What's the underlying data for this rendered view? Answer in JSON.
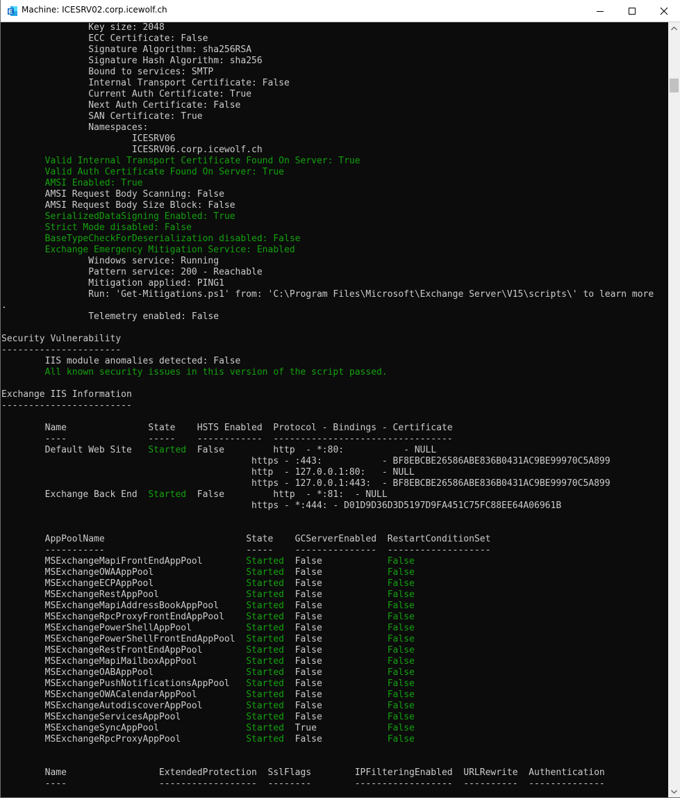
{
  "window": {
    "title": "Machine: ICESRV02.corp.icewolf.ch",
    "icon": "exchange-app-icon",
    "controls": {
      "minimize": "minimize-icon",
      "maximize": "maximize-icon",
      "close": "close-icon"
    }
  },
  "colors": {
    "background": "#0c0c0c",
    "text": "#cccccc",
    "green": "#13a10e",
    "titlebar": "#ffffff",
    "exchange_blue": "#0f6ec6"
  },
  "scrollbar": {
    "thumb_position": 0.06
  },
  "console": {
    "lines": [
      {
        "text": "                Key size: 2048"
      },
      {
        "text": "                ECC Certificate: False"
      },
      {
        "text": "                Signature Algorithm: sha256RSA"
      },
      {
        "text": "                Signature Hash Algorithm: sha256"
      },
      {
        "text": "                Bound to services: SMTP"
      },
      {
        "text": "                Internal Transport Certificate: False"
      },
      {
        "text": "                Current Auth Certificate: True"
      },
      {
        "text": "                Next Auth Certificate: False"
      },
      {
        "text": "                SAN Certificate: True"
      },
      {
        "text": "                Namespaces:"
      },
      {
        "text": "                        ICESRV06"
      },
      {
        "text": "                        ICESRV06.corp.icewolf.ch"
      },
      {
        "text": "        Valid Internal Transport Certificate Found On Server: True",
        "color": "green"
      },
      {
        "text": "        Valid Auth Certificate Found On Server: True",
        "color": "green"
      },
      {
        "text": "        AMSI Enabled: True",
        "color": "green"
      },
      {
        "text": "        AMSI Request Body Scanning: False"
      },
      {
        "text": "        AMSI Request Body Size Block: False"
      },
      {
        "text": "        SerializedDataSigning Enabled: True",
        "color": "green"
      },
      {
        "text": "        Strict Mode disabled: False",
        "color": "green"
      },
      {
        "text": "        BaseTypeCheckForDeserialization disabled: False",
        "color": "green"
      },
      {
        "text": "        Exchange Emergency Mitigation Service: Enabled",
        "color": "green"
      },
      {
        "text": "                Windows service: Running"
      },
      {
        "text": "                Pattern service: 200 - Reachable"
      },
      {
        "text": "                Mitigation applied: PING1"
      },
      {
        "text": "                Run: 'Get-Mitigations.ps1' from: 'C:\\Program Files\\Microsoft\\Exchange Server\\V15\\scripts\\' to learn more"
      },
      {
        "text": "."
      },
      {
        "text": "                Telemetry enabled: False"
      },
      {
        "text": ""
      },
      {
        "text": "Security Vulnerability"
      },
      {
        "text": "----------------------"
      },
      {
        "text": "        IIS module anomalies detected: False"
      },
      {
        "text": "        All known security issues in this version of the script passed.",
        "color": "green"
      },
      {
        "text": ""
      },
      {
        "text": "Exchange IIS Information"
      },
      {
        "text": "------------------------"
      },
      {
        "text": ""
      },
      {
        "text": "        Name               State    HSTS Enabled  Protocol - Bindings - Certificate"
      },
      {
        "text": "        ----               -----    ------------  ---------------------------------"
      },
      {
        "segments": [
          {
            "text": "        Default Web Site   "
          },
          {
            "text": "Started",
            "color": "green"
          },
          {
            "text": "  False         http  - *:80:           - NULL"
          }
        ]
      },
      {
        "text": "                                              https - :443:           - BF8EBCBE26586ABE836B0431AC9BE99970C5A899"
      },
      {
        "text": "                                              http  - 127.0.0.1:80:   - NULL"
      },
      {
        "text": "                                              https - 127.0.0.1:443:  - BF8EBCBE26586ABE836B0431AC9BE99970C5A899"
      },
      {
        "segments": [
          {
            "text": "        Exchange Back End  "
          },
          {
            "text": "Started",
            "color": "green"
          },
          {
            "text": "  False         http  - *:81:  - NULL"
          }
        ]
      },
      {
        "text": "                                              https - *:444: - D01D9D36D3D5197D9FA451C75FC88EE64A06961B"
      },
      {
        "text": ""
      },
      {
        "text": ""
      },
      {
        "text": "        AppPoolName                          State    GCServerEnabled  RestartConditionSet"
      },
      {
        "text": "        -----------                          -----    ---------------  -------------------"
      },
      {
        "segments": [
          {
            "text": "        MSExchangeMapiFrontEndAppPool        "
          },
          {
            "text": "Started",
            "color": "green"
          },
          {
            "text": "  False            "
          },
          {
            "text": "False",
            "color": "green"
          }
        ]
      },
      {
        "segments": [
          {
            "text": "        MSExchangeOWAAppPool                 "
          },
          {
            "text": "Started",
            "color": "green"
          },
          {
            "text": "  False            "
          },
          {
            "text": "False",
            "color": "green"
          }
        ]
      },
      {
        "segments": [
          {
            "text": "        MSExchangeECPAppPool                 "
          },
          {
            "text": "Started",
            "color": "green"
          },
          {
            "text": "  False            "
          },
          {
            "text": "False",
            "color": "green"
          }
        ]
      },
      {
        "segments": [
          {
            "text": "        MSExchangeRestAppPool                "
          },
          {
            "text": "Started",
            "color": "green"
          },
          {
            "text": "  False            "
          },
          {
            "text": "False",
            "color": "green"
          }
        ]
      },
      {
        "segments": [
          {
            "text": "        MSExchangeMapiAddressBookAppPool     "
          },
          {
            "text": "Started",
            "color": "green"
          },
          {
            "text": "  False            "
          },
          {
            "text": "False",
            "color": "green"
          }
        ]
      },
      {
        "segments": [
          {
            "text": "        MSExchangeRpcProxyFrontEndAppPool    "
          },
          {
            "text": "Started",
            "color": "green"
          },
          {
            "text": "  False            "
          },
          {
            "text": "False",
            "color": "green"
          }
        ]
      },
      {
        "segments": [
          {
            "text": "        MSExchangePowerShellAppPool          "
          },
          {
            "text": "Started",
            "color": "green"
          },
          {
            "text": "  False            "
          },
          {
            "text": "False",
            "color": "green"
          }
        ]
      },
      {
        "segments": [
          {
            "text": "        MSExchangePowerShellFrontEndAppPool  "
          },
          {
            "text": "Started",
            "color": "green"
          },
          {
            "text": "  False            "
          },
          {
            "text": "False",
            "color": "green"
          }
        ]
      },
      {
        "segments": [
          {
            "text": "        MSExchangeRestFrontEndAppPool        "
          },
          {
            "text": "Started",
            "color": "green"
          },
          {
            "text": "  False            "
          },
          {
            "text": "False",
            "color": "green"
          }
        ]
      },
      {
        "segments": [
          {
            "text": "        MSExchangeMapiMailboxAppPool         "
          },
          {
            "text": "Started",
            "color": "green"
          },
          {
            "text": "  False            "
          },
          {
            "text": "False",
            "color": "green"
          }
        ]
      },
      {
        "segments": [
          {
            "text": "        MSExchangeOABAppPool                 "
          },
          {
            "text": "Started",
            "color": "green"
          },
          {
            "text": "  False            "
          },
          {
            "text": "False",
            "color": "green"
          }
        ]
      },
      {
        "segments": [
          {
            "text": "        MSExchangePushNotificationsAppPool   "
          },
          {
            "text": "Started",
            "color": "green"
          },
          {
            "text": "  False            "
          },
          {
            "text": "False",
            "color": "green"
          }
        ]
      },
      {
        "segments": [
          {
            "text": "        MSExchangeOWACalendarAppPool         "
          },
          {
            "text": "Started",
            "color": "green"
          },
          {
            "text": "  False            "
          },
          {
            "text": "False",
            "color": "green"
          }
        ]
      },
      {
        "segments": [
          {
            "text": "        MSExchangeAutodiscoverAppPool        "
          },
          {
            "text": "Started",
            "color": "green"
          },
          {
            "text": "  False            "
          },
          {
            "text": "False",
            "color": "green"
          }
        ]
      },
      {
        "segments": [
          {
            "text": "        MSExchangeServicesAppPool            "
          },
          {
            "text": "Started",
            "color": "green"
          },
          {
            "text": "  False            "
          },
          {
            "text": "False",
            "color": "green"
          }
        ]
      },
      {
        "segments": [
          {
            "text": "        MSExchangeSyncAppPool                "
          },
          {
            "text": "Started",
            "color": "green"
          },
          {
            "text": "  True             "
          },
          {
            "text": "False",
            "color": "green"
          }
        ]
      },
      {
        "segments": [
          {
            "text": "        MSExchangeRpcProxyAppPool            "
          },
          {
            "text": "Started",
            "color": "green"
          },
          {
            "text": "  False            "
          },
          {
            "text": "False",
            "color": "green"
          }
        ]
      },
      {
        "text": ""
      },
      {
        "text": ""
      },
      {
        "text": "        Name                 ExtendedProtection  SslFlags        IPFilteringEnabled  URLRewrite  Authentication"
      },
      {
        "text": "        ----                 ------------------  --------        ------------------  ----------  --------------"
      }
    ]
  }
}
